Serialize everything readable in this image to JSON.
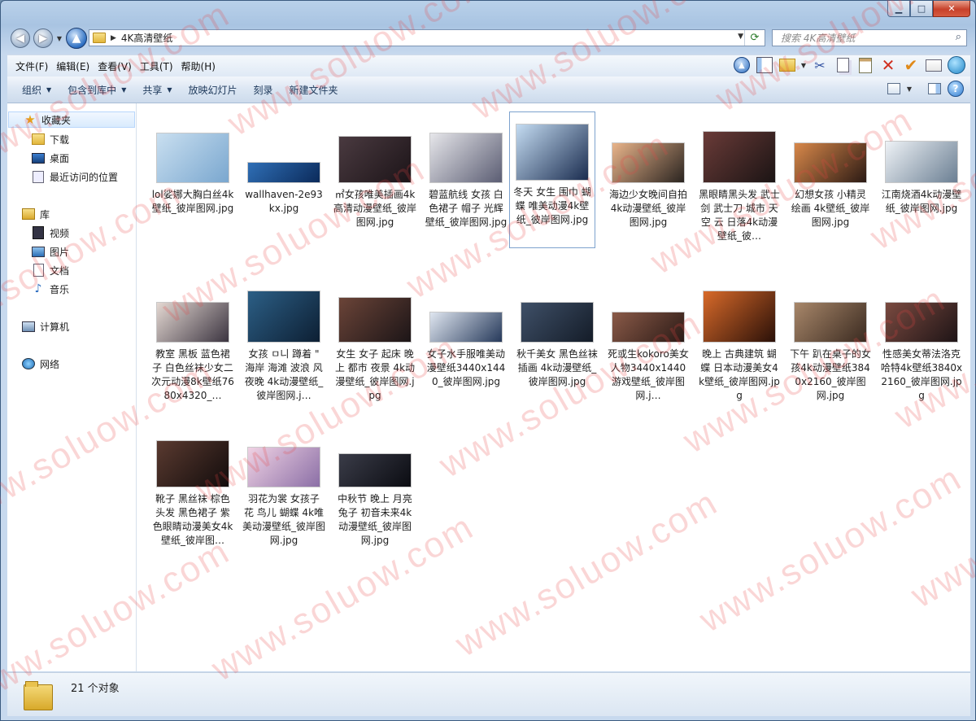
{
  "window": {
    "caption_buttons": {
      "minimize": "▁",
      "maximize": "□",
      "close": "✕"
    }
  },
  "address": {
    "path": "4K高清壁纸"
  },
  "search": {
    "placeholder": "搜索 4K高清壁纸"
  },
  "menu": [
    "文件(F)",
    "编辑(E)",
    "查看(V)",
    "工具(T)",
    "帮助(H)"
  ],
  "commands": [
    "组织",
    "包含到库中",
    "共享",
    "放映幻灯片",
    "刻录",
    "新建文件夹"
  ],
  "nav": {
    "favorites": {
      "label": "收藏夹",
      "items": [
        "下载",
        "桌面",
        "最近访问的位置"
      ]
    },
    "libraries": {
      "label": "库",
      "items": [
        "视频",
        "图片",
        "文档",
        "音乐"
      ]
    },
    "computer": "计算机",
    "network": "网络"
  },
  "files": [
    {
      "name": "lol娑娜大胸白丝4k壁纸_彼岸图网.jpg",
      "colors": [
        "#c9dff0",
        "#7aa7cf"
      ]
    },
    {
      "name": "wallhaven-2e93kx.jpg",
      "colors": [
        "#2f6fb6",
        "#0b2a5a"
      ]
    },
    {
      "name": "㎡女孩唯美插画4k高清动漫壁纸_彼岸图网.jpg",
      "colors": [
        "#4a3a40",
        "#1c1418"
      ]
    },
    {
      "name": "碧蓝航线 女孩 白色裙子 帽子 光辉壁纸_彼岸图网.jpg",
      "colors": [
        "#e6e6ea",
        "#5b5d73"
      ]
    },
    {
      "name": "冬天 女生 围巾 蝴蝶 唯美动漫4k壁纸_彼岸图网.jpg",
      "colors": [
        "#c4dcf2",
        "#1a2c4f"
      ]
    },
    {
      "name": "海边少女晚间自拍4k动漫壁纸_彼岸图网.jpg",
      "colors": [
        "#e9b48a",
        "#2a2420"
      ]
    },
    {
      "name": "黑眼睛黑头发 武士 剑 武士刀 城市 天空 云 日落4k动漫壁纸_彼…",
      "colors": [
        "#6a3b38",
        "#1b1414"
      ]
    },
    {
      "name": "幻想女孩 小精灵 绘画 4k壁纸_彼岸图网.jpg",
      "colors": [
        "#d8884a",
        "#2b1a14"
      ]
    },
    {
      "name": "江南烧酒4k动漫壁纸_彼岸图网.jpg",
      "colors": [
        "#eef2f6",
        "#6b7f93"
      ]
    },
    {
      "name": "教室 黑板 蓝色裙子 白色丝袜少女二次元动漫8k壁纸7680x4320_…",
      "colors": [
        "#e4d8d2",
        "#3b3440"
      ]
    },
    {
      "name": "女孩 ㅁ니 蹲着 \" 海岸 海滩 波浪 风 夜晚 4k动漫壁纸_彼岸图网.j…",
      "colors": [
        "#2c5f86",
        "#0d1f33"
      ]
    },
    {
      "name": "女生 女子 起床 晚上 都市 夜景 4k动漫壁纸_彼岸图网.jpg",
      "colors": [
        "#6b4438",
        "#1c1517"
      ]
    },
    {
      "name": "女子水手服唯美动漫壁纸3440x1440_彼岸图网.jpg",
      "colors": [
        "#dfe6f0",
        "#26395a"
      ]
    },
    {
      "name": "秋千美女 黑色丝袜 插画 4k动漫壁纸_彼岸图网.jpg",
      "colors": [
        "#3f5068",
        "#141c28"
      ]
    },
    {
      "name": "死或生kokoro美女人物3440x1440游戏壁纸_彼岸图网.j…",
      "colors": [
        "#8a5a48",
        "#2b1a16"
      ]
    },
    {
      "name": "晚上 古典建筑 蝴蝶 日本动漫美女4k壁纸_彼岸图网.jpg",
      "colors": [
        "#d86a2a",
        "#2a1008"
      ]
    },
    {
      "name": "下午 趴在桌子的女孩4k动漫壁纸3840x2160_彼岸图网.jpg",
      "colors": [
        "#a8876a",
        "#3a2a20"
      ]
    },
    {
      "name": "性感美女蒂法洛克哈特4k壁纸3840x2160_彼岸图网.jpg",
      "colors": [
        "#7a4a40",
        "#1e1416"
      ]
    },
    {
      "name": "靴子 黑丝袜 棕色头发 黑色裙子 紫色眼睛动漫美女4k壁纸_彼岸图…",
      "colors": [
        "#5a3a30",
        "#120c0c"
      ]
    },
    {
      "name": "羽花为裳 女孩子 花 鸟儿 蝴蝶 4k唯美动漫壁纸_彼岸图网.jpg",
      "colors": [
        "#f0d2e4",
        "#8b6fa6"
      ]
    },
    {
      "name": "中秋节 晚上 月亮 兔子 初音未来4k动漫壁纸_彼岸图网.jpg",
      "colors": [
        "#3a3c48",
        "#0b0c12"
      ]
    }
  ],
  "status": {
    "count": "21 个对象"
  },
  "watermark": "www.soluow.com"
}
